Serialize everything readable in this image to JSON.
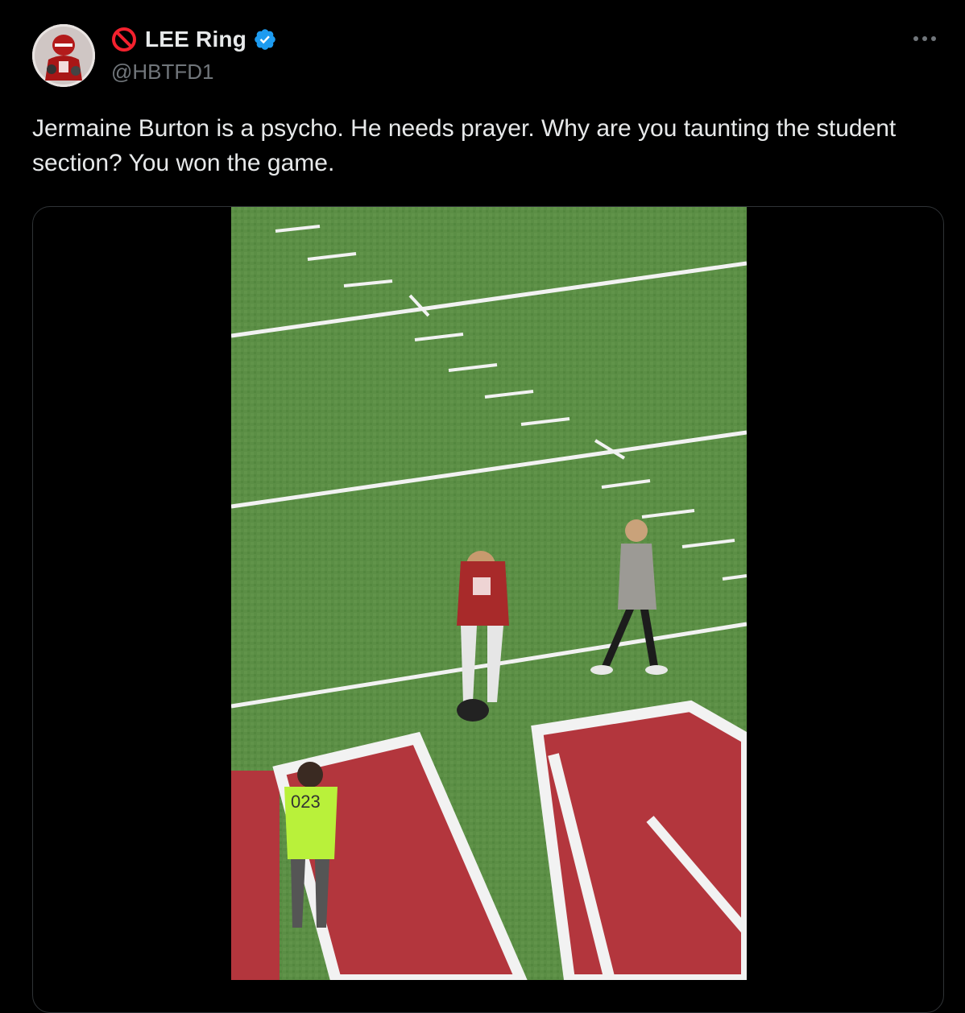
{
  "author": {
    "display_name": "LEE Ring",
    "handle": "@HBTFD1",
    "verified": true,
    "avatar_icon": "football-player-avatar",
    "name_prefix_icon": "no-entry-icon"
  },
  "tweet": {
    "text": "Jermaine Burton is a psycho. He needs prayer. Why are you taunting the student section? You won the game."
  },
  "media": {
    "type": "video",
    "jersey_number_visible": "023"
  },
  "colors": {
    "background": "#000000",
    "text_primary": "#e7e9ea",
    "text_secondary": "#71767b",
    "verified_blue": "#1d9bf0",
    "no_entry_red": "#f4212e",
    "border": "#2f3336"
  },
  "icons": {
    "more": "more-horizontal-icon",
    "verified": "verified-badge-icon"
  }
}
